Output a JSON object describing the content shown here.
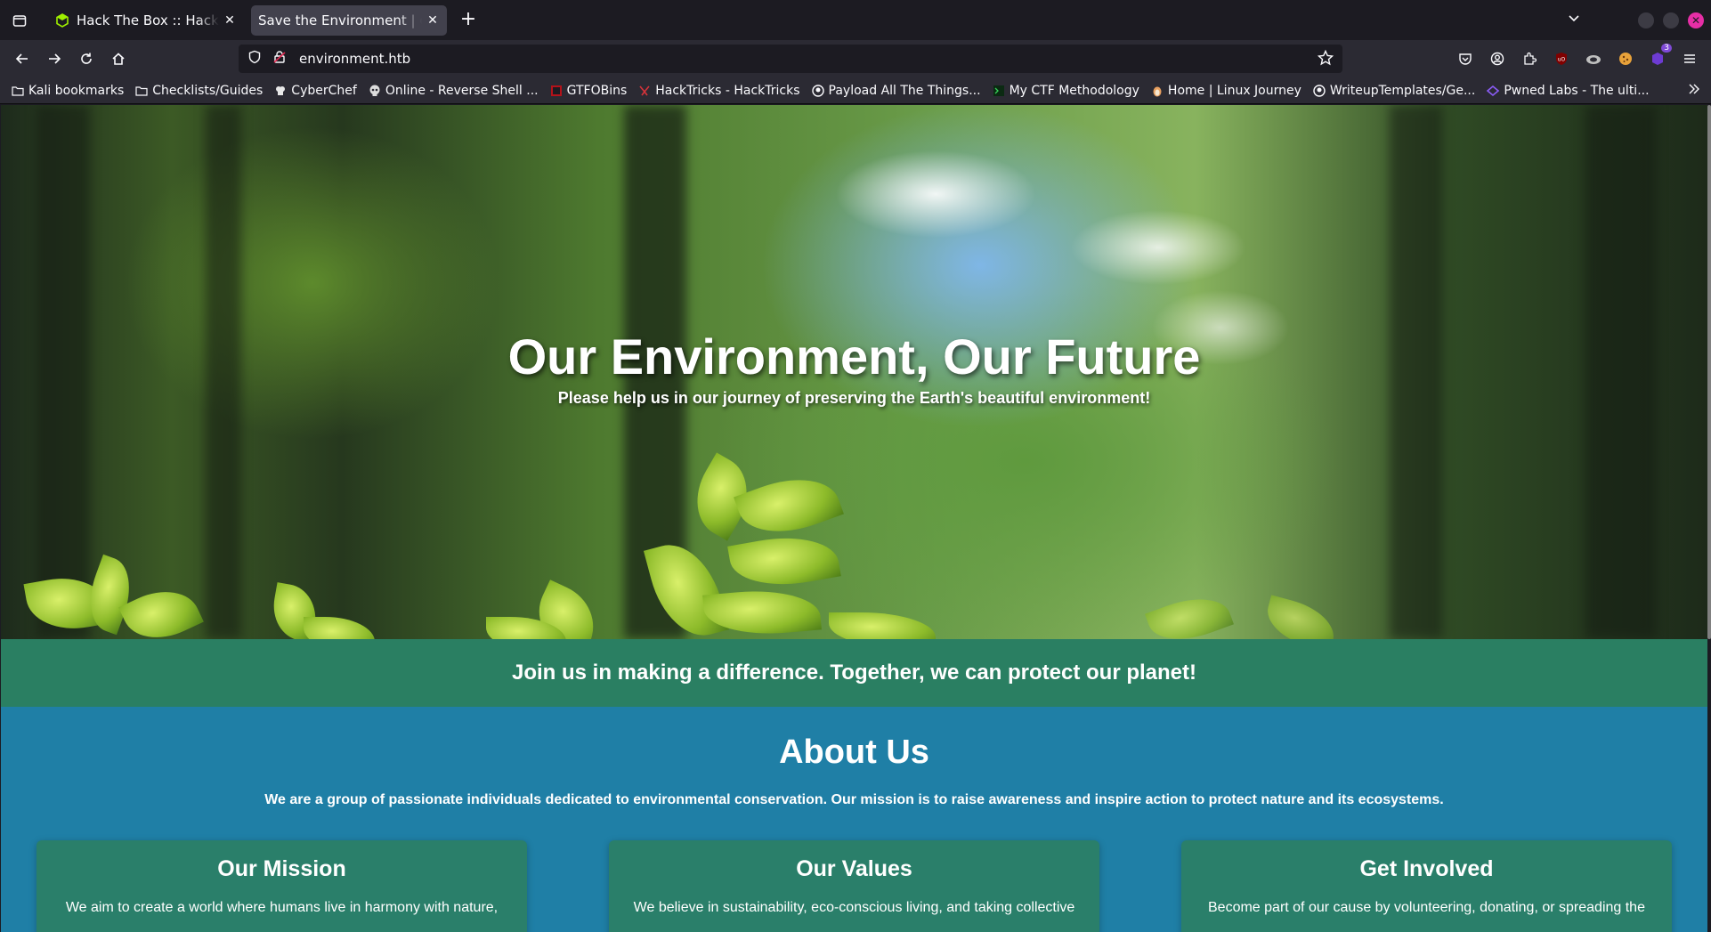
{
  "browser": {
    "tabs": [
      {
        "title": "Hack The Box :: Hack The Box",
        "active": false
      },
      {
        "title": "Save the Environment | environment.htb",
        "active": true
      }
    ],
    "url": "environment.htb",
    "bookmarks": [
      {
        "label": "Kali bookmarks",
        "icon": "folder-icon"
      },
      {
        "label": "Checklists/Guides",
        "icon": "folder-icon"
      },
      {
        "label": "CyberChef",
        "icon": "chef-icon"
      },
      {
        "label": "Online - Reverse Shell ...",
        "icon": "skull-icon"
      },
      {
        "label": "GTFOBins",
        "icon": "gtfobins-icon"
      },
      {
        "label": "HackTricks - HackTricks",
        "icon": "hacktricks-icon"
      },
      {
        "label": "Payload All The Things...",
        "icon": "github-icon"
      },
      {
        "label": "My CTF Methodology",
        "icon": "terminal-icon"
      },
      {
        "label": "Home | Linux Journey",
        "icon": "penguin-icon"
      },
      {
        "label": "WriteupTemplates/Ge...",
        "icon": "github-icon"
      },
      {
        "label": "Pwned Labs - The ulti...",
        "icon": "pwnedlabs-icon"
      }
    ],
    "extension_badge": "3"
  },
  "page": {
    "hero": {
      "title": "Our Environment, Our Future",
      "subtitle": "Please help us in our journey of preserving the Earth's beautiful environment!"
    },
    "cta": "Join us in making a difference. Together, we can protect our planet!",
    "about": {
      "title": "About Us",
      "text": "We are a group of passionate individuals dedicated to environmental conservation. Our mission is to raise awareness and inspire action to protect nature and its ecosystems.",
      "cards": [
        {
          "title": "Our Mission",
          "text": "We aim to create a world where humans live in harmony with nature,"
        },
        {
          "title": "Our Values",
          "text": "We believe in sustainability, eco-conscious living, and taking collective"
        },
        {
          "title": "Get Involved",
          "text": "Become part of our cause by volunteering, donating, or spreading the"
        }
      ]
    }
  },
  "colors": {
    "cta_bg": "#2a7f62",
    "about_bg": "#1f7fa6",
    "card_bg": "#2a7f6a"
  }
}
